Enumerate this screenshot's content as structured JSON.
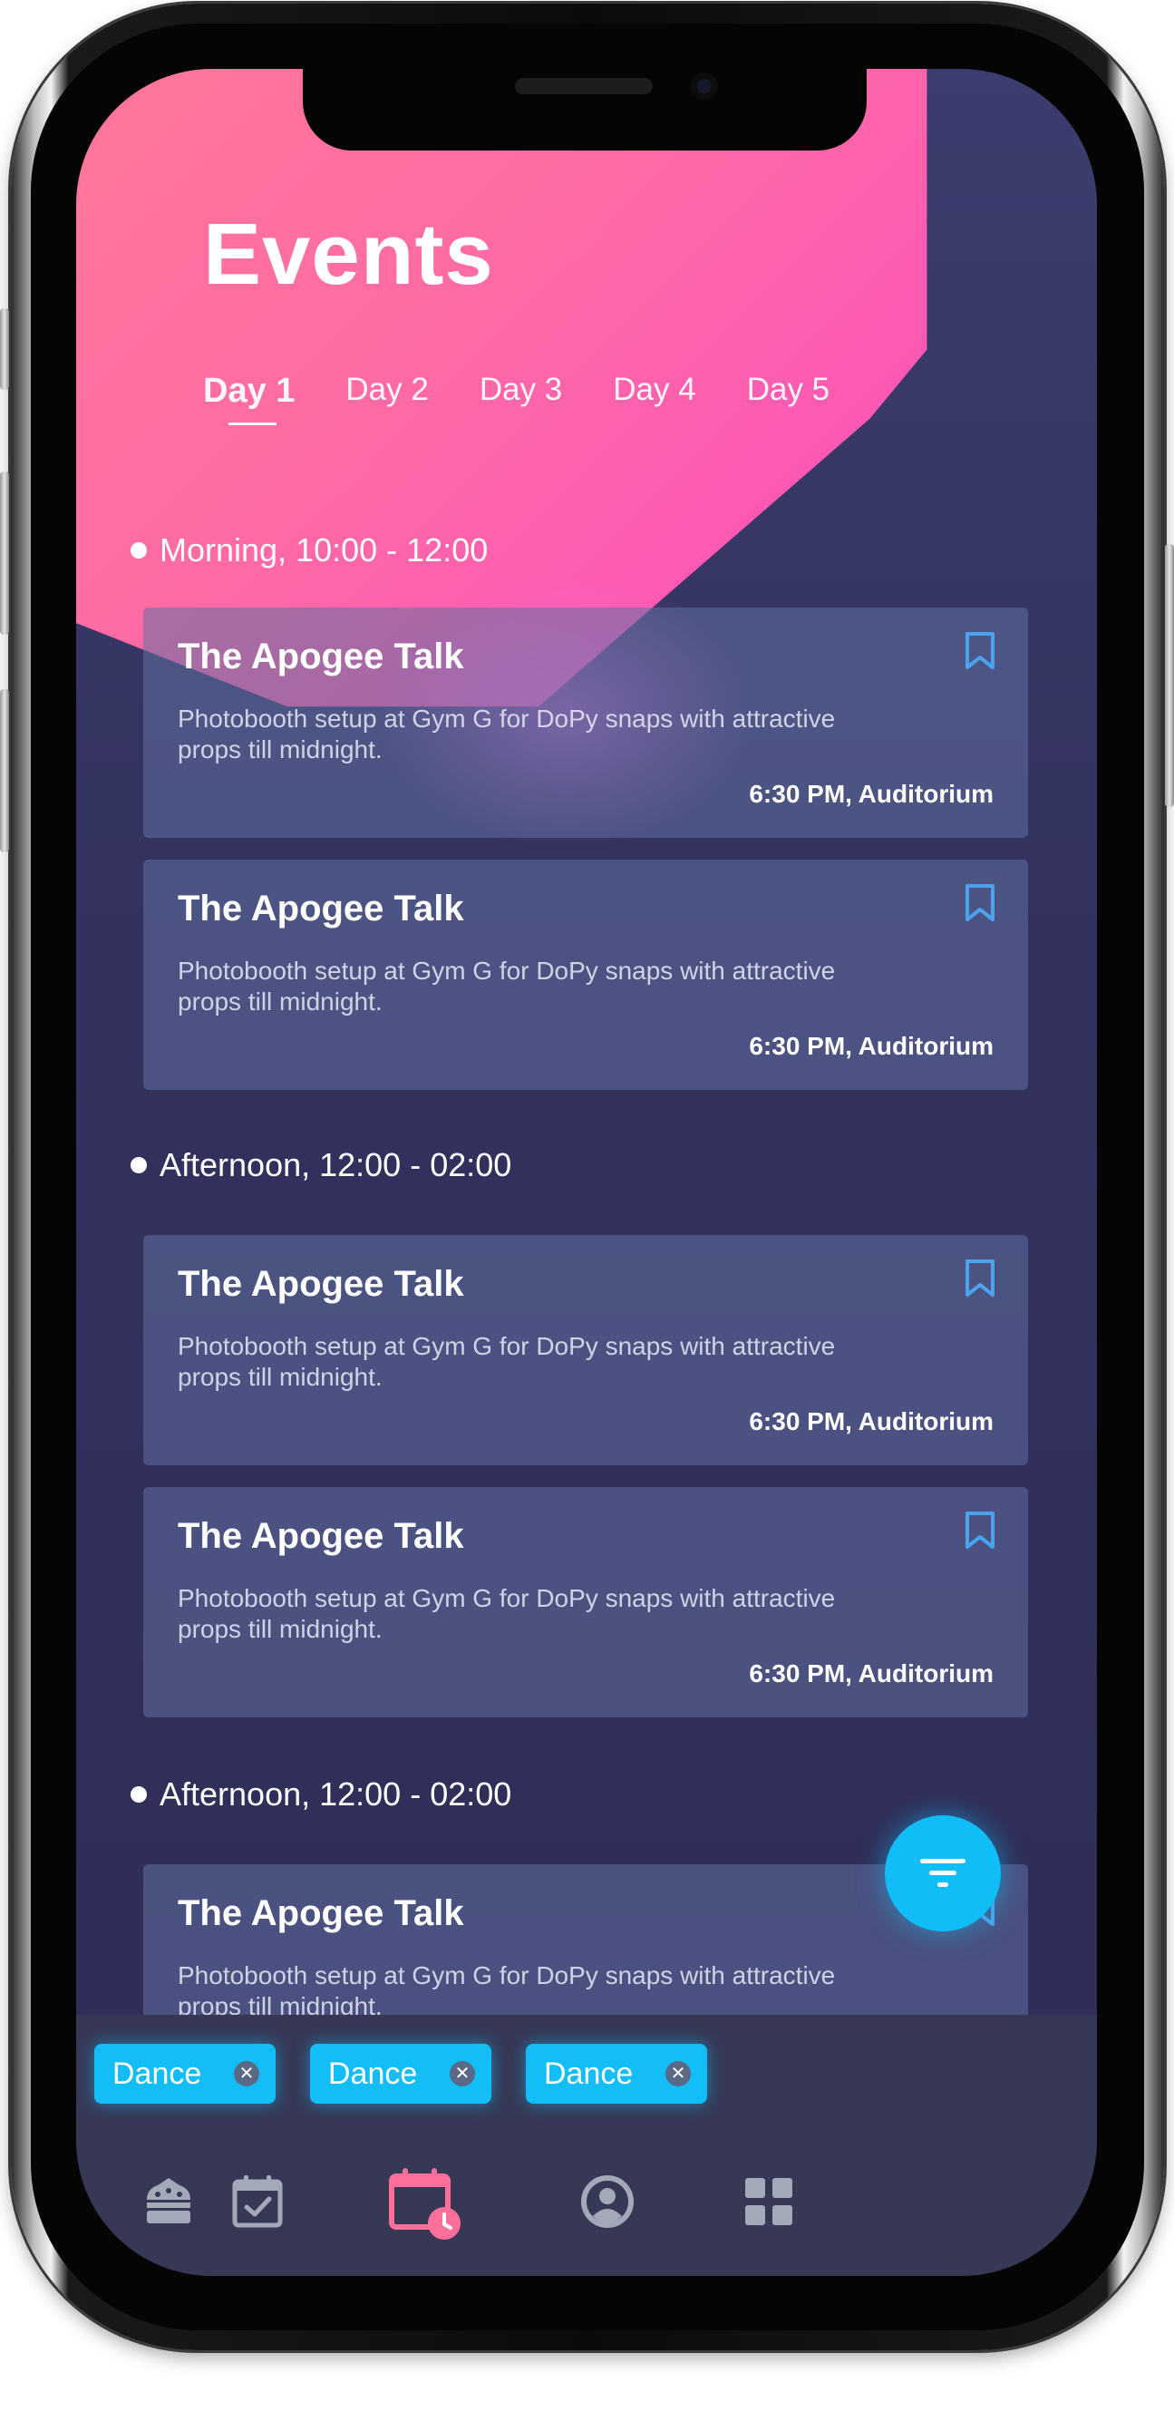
{
  "app": {
    "title": "Events"
  },
  "tabs": [
    {
      "label": "Day 1",
      "active": true
    },
    {
      "label": "Day 2",
      "active": false
    },
    {
      "label": "Day 3",
      "active": false
    },
    {
      "label": "Day 4",
      "active": false
    },
    {
      "label": "Day 5",
      "active": false
    }
  ],
  "sections": [
    {
      "header": "Morning, 10:00 - 12:00",
      "events": [
        {
          "title": "The Apogee Talk",
          "description": "Photobooth setup at Gym G for DoPy snaps with attractive props till midnight.",
          "meta": "6:30 PM, Auditorium"
        },
        {
          "title": "The Apogee Talk",
          "description": "Photobooth setup at Gym G for DoPy snaps with attractive props till midnight.",
          "meta": "6:30 PM, Auditorium"
        }
      ]
    },
    {
      "header": "Afternoon, 12:00 - 02:00",
      "events": [
        {
          "title": "The Apogee Talk",
          "description": "Photobooth setup at Gym G for DoPy snaps with attractive props till midnight.",
          "meta": "6:30 PM, Auditorium"
        },
        {
          "title": "The Apogee Talk",
          "description": "Photobooth setup at Gym G for DoPy snaps with attractive props till midnight.",
          "meta": "6:30 PM, Auditorium"
        }
      ]
    },
    {
      "header": "Afternoon, 12:00 - 02:00",
      "events": [
        {
          "title": "The Apogee Talk",
          "description": "Photobooth setup at Gym G for DoPy snaps with attractive props till midnight.",
          "meta": ""
        }
      ]
    }
  ],
  "filter_chips": [
    {
      "label": "Dance"
    },
    {
      "label": "Dance"
    },
    {
      "label": "Dance"
    }
  ],
  "bottom_nav": [
    {
      "icon": "home-icon",
      "active": false
    },
    {
      "icon": "calendar-check-icon",
      "active": false
    },
    {
      "icon": "calendar-clock-icon",
      "active": true
    },
    {
      "icon": "profile-icon",
      "active": false
    },
    {
      "icon": "grid-icon",
      "active": false
    }
  ],
  "icons": {
    "bookmark": "bookmark-icon",
    "filter": "filter-icon",
    "chip_close": "close-icon"
  },
  "colors": {
    "accent": "#13bdf6",
    "nav_active": "#ff6f9a",
    "nav_inactive": "#a3a9b8",
    "bookmark": "#4ba3f0",
    "background": "#33325e",
    "header_gradient_start": "#ff8090",
    "header_gradient_end": "#fb4dbd"
  }
}
